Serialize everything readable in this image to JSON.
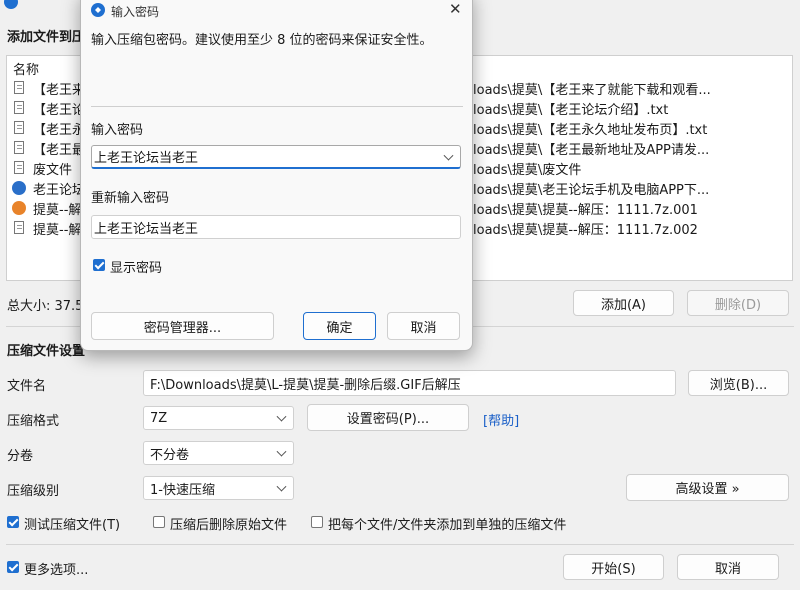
{
  "main": {
    "add_section_title": "添加文件到压",
    "list": {
      "column_name": "名称",
      "rows": [
        {
          "name": "【老王来",
          "path": "loads\\提莫\\【老王来了就能下载和观看...",
          "icon": "file-icon"
        },
        {
          "name": "【老王论",
          "path": "loads\\提莫\\【老王论坛介绍】.txt",
          "icon": "file-icon"
        },
        {
          "name": "【老王永",
          "path": "loads\\提莫\\【老王永久地址发布页】.txt",
          "icon": "file-icon"
        },
        {
          "name": "【老王最",
          "path": "loads\\提莫\\【老王最新地址及APP请发...",
          "icon": "file-icon"
        },
        {
          "name": "废文件",
          "path": "loads\\提莫\\废文件",
          "icon": "file-icon"
        },
        {
          "name": "老王论坛",
          "path": "loads\\提莫\\老王论坛手机及电脑APP下...",
          "icon": "app-icon"
        },
        {
          "name": "提莫--解",
          "path": "loads\\提莫\\提莫--解压：1111.7z.001",
          "icon": "archive-icon"
        },
        {
          "name": "提莫--解",
          "path": "loads\\提莫\\提莫--解压：1111.7z.002",
          "icon": "file-icon"
        }
      ]
    },
    "total_size": "总大小: 37.5",
    "add_button": "添加(A)",
    "delete_button": "删除(D)",
    "compress_settings_title": "压缩文件设置",
    "filename_label": "文件名",
    "filename_value": "F:\\Downloads\\提莫\\L-提莫\\提莫-删除后缀.GIF后解压",
    "browse_button": "浏览(B)...",
    "format_label": "压缩格式",
    "format_value": "7Z",
    "set_password_button": "设置密码(P)...",
    "help_link": "[帮助]",
    "split_label": "分卷",
    "split_value": "不分卷",
    "level_label": "压缩级别",
    "level_value": "1-快速压缩",
    "advanced_button": "高级设置 »",
    "test_checkbox": "测试压缩文件(T)",
    "delete_after_checkbox": "压缩后删除原始文件",
    "each_file_checkbox": "把每个文件/文件夹添加到单独的压缩文件",
    "more_options_checkbox": "更多选项...",
    "start_button": "开始(S)",
    "cancel_button": "取消"
  },
  "dialog": {
    "title": "输入密码",
    "description": "输入压缩包密码。建议使用至少 8 位的密码来保证安全性。",
    "password_label": "输入密码",
    "password_value": "上老王论坛当老王",
    "confirm_label": "重新输入密码",
    "confirm_value": "上老王论坛当老王",
    "show_password_checkbox": "显示密码",
    "password_manager_button": "密码管理器...",
    "ok_button": "确定",
    "cancel_button": "取消",
    "close_symbol": "✕"
  },
  "colors": {
    "accent": "#1f6fd0",
    "help_link": "#1a5fc8"
  }
}
